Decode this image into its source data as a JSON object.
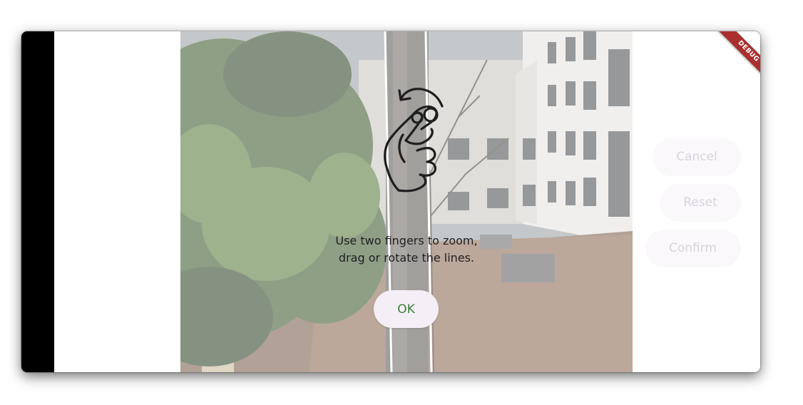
{
  "overlay": {
    "instruction_line1": "Use two fingers to zoom,",
    "instruction_line2": "drag or rotate the lines.",
    "ok_label": "OK",
    "gesture_icon": "two-finger-rotate-gesture-icon"
  },
  "actions": {
    "cancel_label": "Cancel",
    "reset_label": "Reset",
    "confirm_label": "Confirm"
  },
  "debug_banner": {
    "label": "DEBUG"
  },
  "colors": {
    "ok_text": "#3f7d3a",
    "button_bg": "#f4eff6",
    "disabled_text": "#d9d2dd",
    "debug_ribbon": "#a9302f",
    "system_bar": "#000000"
  }
}
